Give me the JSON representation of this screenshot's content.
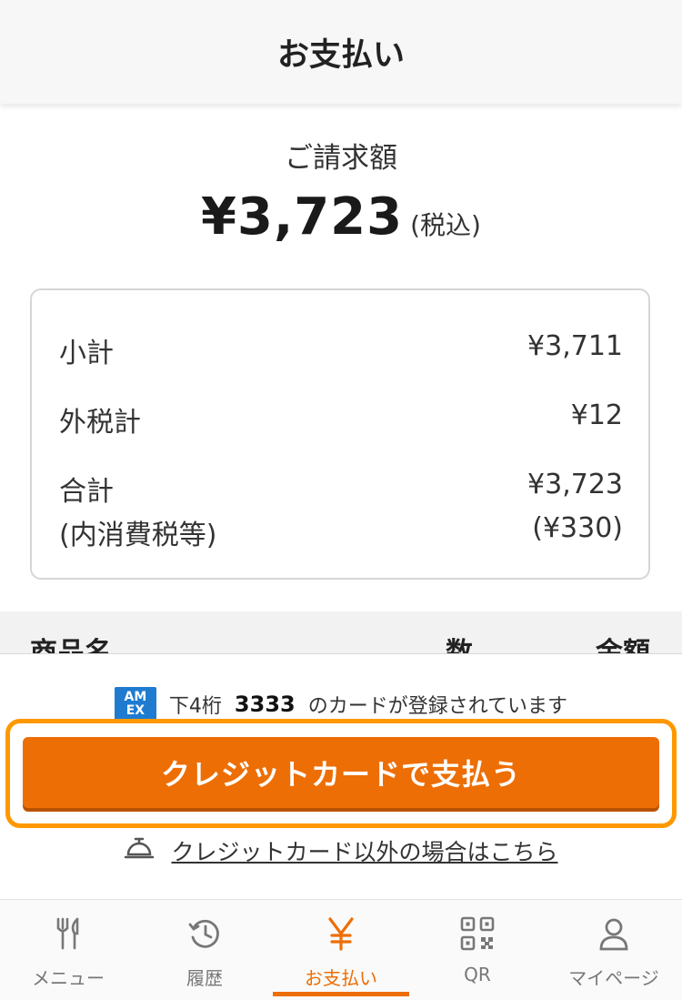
{
  "header": {
    "title": "お支払い"
  },
  "billing": {
    "label": "ご請求額",
    "amount": "¥3,723",
    "tax_note": "(税込)"
  },
  "summary": {
    "subtotal_label": "小計",
    "subtotal_value": "¥3,711",
    "outer_tax_label": "外税計",
    "outer_tax_value": "¥12",
    "total_label": "合計",
    "total_value": "¥3,723",
    "inner_tax_label": "(内消費税等)",
    "inner_tax_value": "(¥330)"
  },
  "table": {
    "col_item": "商品名",
    "col_qty": "数",
    "col_amount": "金額"
  },
  "payment": {
    "card_brand_top": "AM",
    "card_brand_bottom": "EX",
    "card_prefix": "下4桁",
    "card_digits": "3333",
    "card_suffix": "のカードが登録されています",
    "pay_button_label": "クレジットカードで支払う",
    "alt_link_label": "クレジットカード以外の場合はこちら"
  },
  "tabs": [
    {
      "label": "メニュー",
      "icon": "fork-knife-icon"
    },
    {
      "label": "履歴",
      "icon": "history-icon"
    },
    {
      "label": "お支払い",
      "icon": "yen-icon",
      "active": true
    },
    {
      "label": "QR",
      "icon": "qr-code-icon"
    },
    {
      "label": "マイページ",
      "icon": "user-icon"
    }
  ],
  "colors": {
    "accent": "#ed6e05",
    "focus_ring": "#ff9800",
    "amex_blue": "#1e7bd0"
  }
}
